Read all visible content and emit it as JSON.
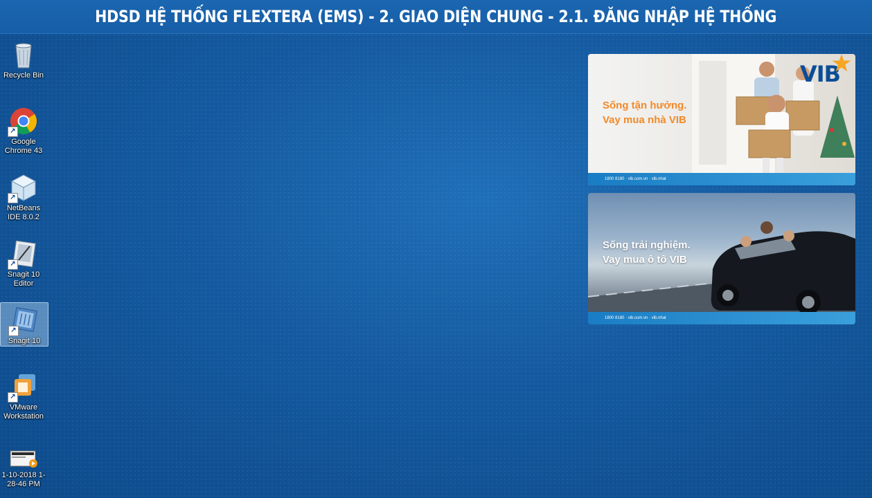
{
  "title": "HDSD HỆ THỐNG FLEXTERA (EMS) - 2. GIAO DIỆN CHUNG - 2.1. ĐĂNG NHẬP HỆ THỐNG",
  "desktop_icons": [
    {
      "label": "Recycle Bin",
      "icon": "recycle-bin-icon"
    },
    {
      "label": "Google Chrome 43",
      "icon": "chrome-icon"
    },
    {
      "label": "NetBeans IDE 8.0.2",
      "icon": "netbeans-icon"
    },
    {
      "label": "Snagit 10 Editor",
      "icon": "snagit-editor-icon"
    },
    {
      "label": "Snagit 10",
      "icon": "snagit-icon",
      "selected": true
    },
    {
      "label": "VMware Workstation",
      "icon": "vmware-icon"
    },
    {
      "label": "1-10-2018 1-28-46 PM",
      "icon": "video-file-icon"
    }
  ],
  "ads": [
    {
      "line1": "Sống tận hưởng.",
      "line2": "Vay mua nhà VIB",
      "logo": "VIB",
      "footer": "1800 8180 · vib.com.vn · vib.nhat"
    },
    {
      "line1": "Sống trải nghiệm.",
      "line2": "Vay mua ô tô VIB",
      "footer": "1800 8180 · vib.com.vn · vib.nhat"
    }
  ],
  "colors": {
    "desktop": "#14599f",
    "title_bar": "#1b66b0",
    "ad_orange": "#f28a2a",
    "vib_blue": "#0a4d97"
  }
}
